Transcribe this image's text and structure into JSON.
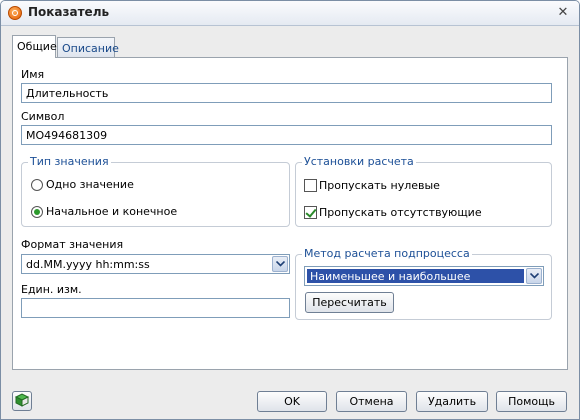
{
  "window": {
    "title": "Показатель"
  },
  "tabs": [
    {
      "label": "Общие"
    },
    {
      "label": "Описание"
    }
  ],
  "fields": {
    "name_label": "Имя",
    "name_value": "Длительность",
    "symbol_label": "Символ",
    "symbol_value": "MO494681309",
    "format_label": "Формат значения",
    "format_value": "dd.MM.yyyy hh:mm:ss",
    "unit_label": "Един. изм.",
    "unit_value": ""
  },
  "value_type": {
    "title": "Тип значения",
    "options": [
      {
        "label": "Одно значение",
        "checked": false
      },
      {
        "label": "Начальное и конечное",
        "checked": true
      }
    ]
  },
  "calc_settings": {
    "title": "Установки расчета",
    "options": [
      {
        "label": "Пропускать нулевые",
        "checked": false
      },
      {
        "label": "Пропускать отсутствующие",
        "checked": true
      }
    ]
  },
  "subprocess": {
    "title": "Метод расчета подпроцесса",
    "method_value": "Наименьшее и наибольшее",
    "recalc_label": "Пересчитать"
  },
  "buttons": {
    "ok": "OK",
    "cancel": "Отмена",
    "delete": "Удалить",
    "help": "Помощь"
  },
  "icons": {
    "app": "app-logo-icon",
    "close": "close-icon",
    "dropdown": "chevron-down-icon",
    "bottom": "book-icon"
  }
}
